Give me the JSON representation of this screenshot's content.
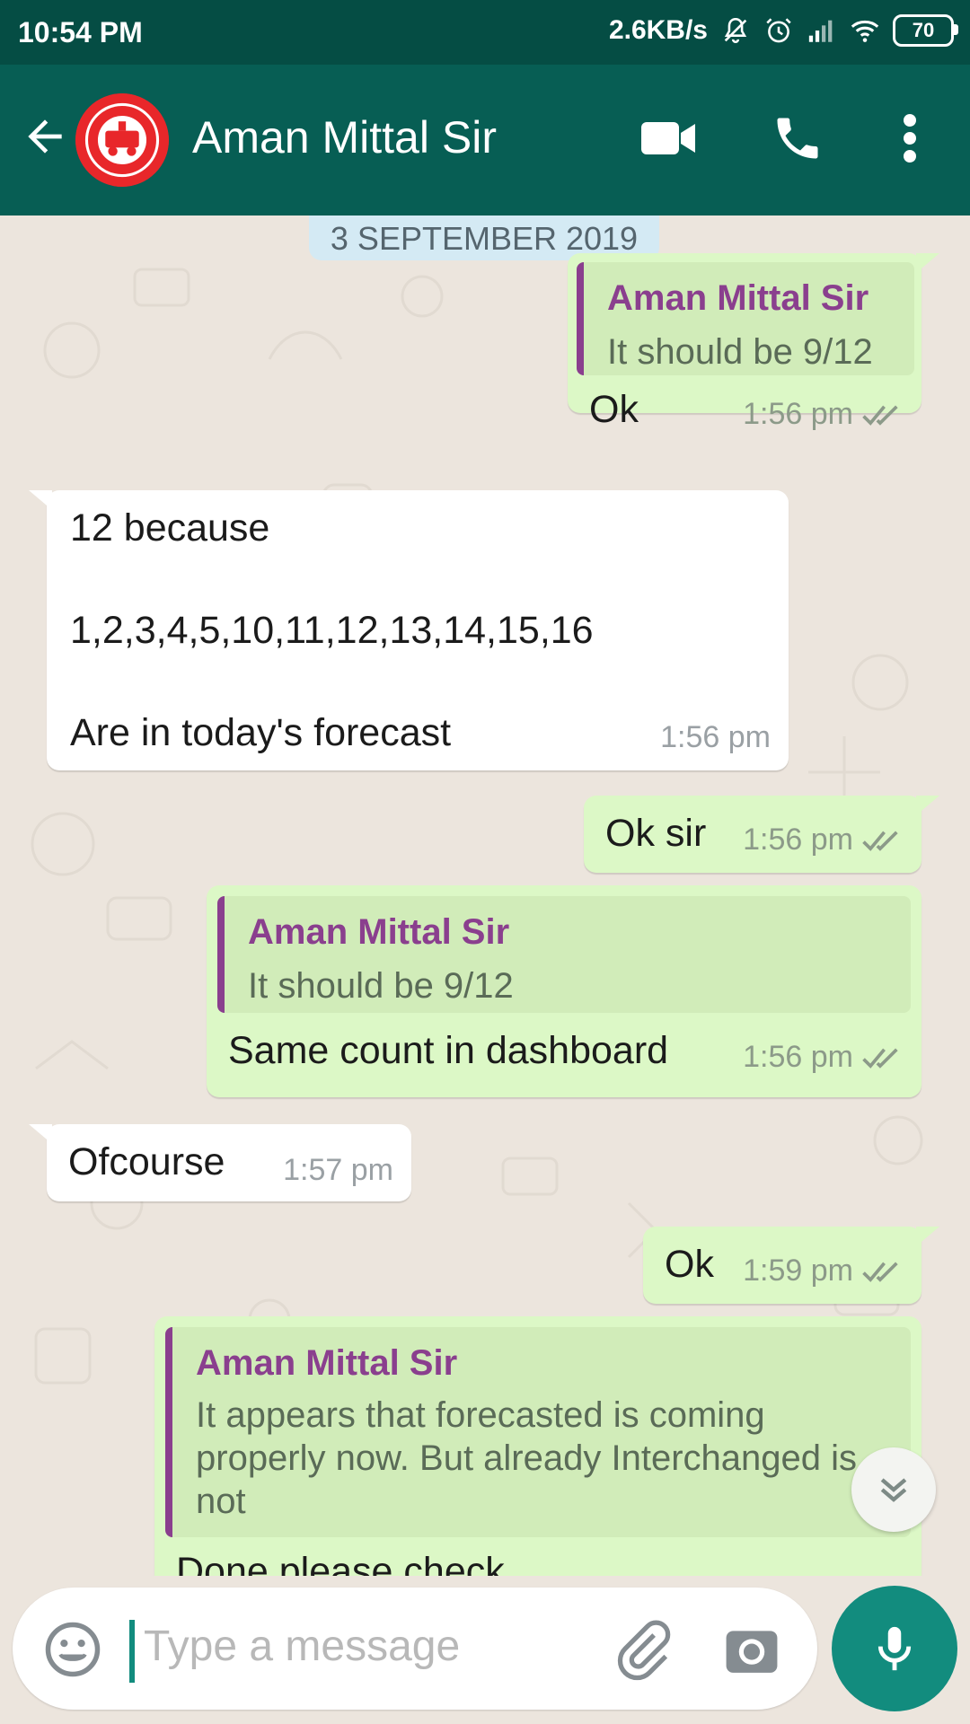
{
  "status_bar": {
    "time": "10:54 PM",
    "network_speed": "2.6KB/s",
    "battery": "70"
  },
  "header": {
    "contact_name": "Aman Mittal Sir",
    "avatar_icon": "indian-railways-logo",
    "actions": [
      "video-call-icon",
      "voice-call-icon",
      "more-options-icon"
    ]
  },
  "colors": {
    "header": "#075e54",
    "status_bar": "#054d44",
    "outgoing_bubble": "#dcf8c6",
    "incoming_bubble": "#ffffff",
    "quote_accent": "#8a3f8e",
    "fab": "#128c7e"
  },
  "chat": {
    "date_label": "3 SEPTEMBER 2019",
    "messages": [
      {
        "direction": "out",
        "quote_name": "Aman Mittal Sir",
        "quote_text": "It should be 9/12",
        "text": "Ok",
        "time": "1:56 pm"
      },
      {
        "direction": "in",
        "lines": [
          "12 because",
          "1,2,3,4,5,10,11,12,13,14,15,16",
          "Are in today's forecast"
        ],
        "time": "1:56 pm"
      },
      {
        "direction": "out",
        "text": "Ok sir",
        "time": "1:56 pm"
      },
      {
        "direction": "out",
        "quote_name": "Aman Mittal Sir",
        "quote_text": "It should be 9/12",
        "text": "Same count in dashboard",
        "time": "1:56 pm"
      },
      {
        "direction": "in",
        "text": "Ofcourse",
        "time": "1:57 pm"
      },
      {
        "direction": "out",
        "text": "Ok",
        "time": "1:59 pm"
      },
      {
        "direction": "out",
        "quote_name": "Aman Mittal Sir",
        "quote_lines": [
          "It appears that forecasted is coming",
          "properly now. But already Interchanged is",
          "not"
        ],
        "text": "Done please check"
      }
    ]
  },
  "composer": {
    "placeholder": "Type a message"
  }
}
